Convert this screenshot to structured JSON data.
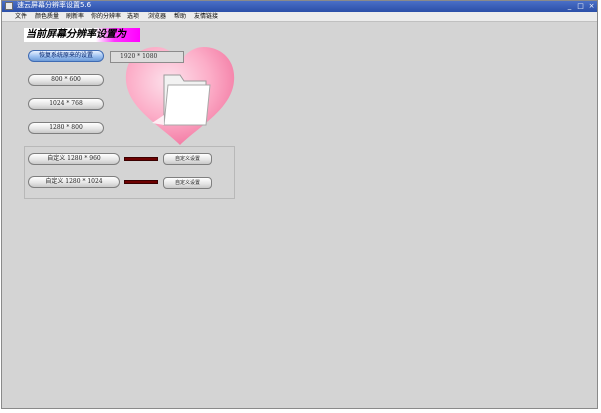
{
  "window": {
    "title": "速云屏幕分辨率设置5.6"
  },
  "menu": [
    "文件",
    "颜色质量",
    "刷新率",
    "你的分辨率",
    "选项",
    "浏览器",
    "帮助",
    "友情链接"
  ],
  "heading": "当前屏幕分辨率设置为",
  "restore_button": "恢复系统原来的设置",
  "current_resolution": "1920 * 1080",
  "presets": [
    "800 * 600",
    "1024 * 768",
    "1280 * 800"
  ],
  "custom": [
    {
      "label": "自定义 1280 * 960",
      "button": "自定义设置"
    },
    {
      "label": "自定义 1280 * 1024",
      "button": "自定义设置"
    }
  ],
  "colors": {
    "titlebar": "#2b4fa8",
    "heading_highlight": "#ff00ff",
    "swatch": "#6e0000",
    "background": "#d4d4d4"
  }
}
